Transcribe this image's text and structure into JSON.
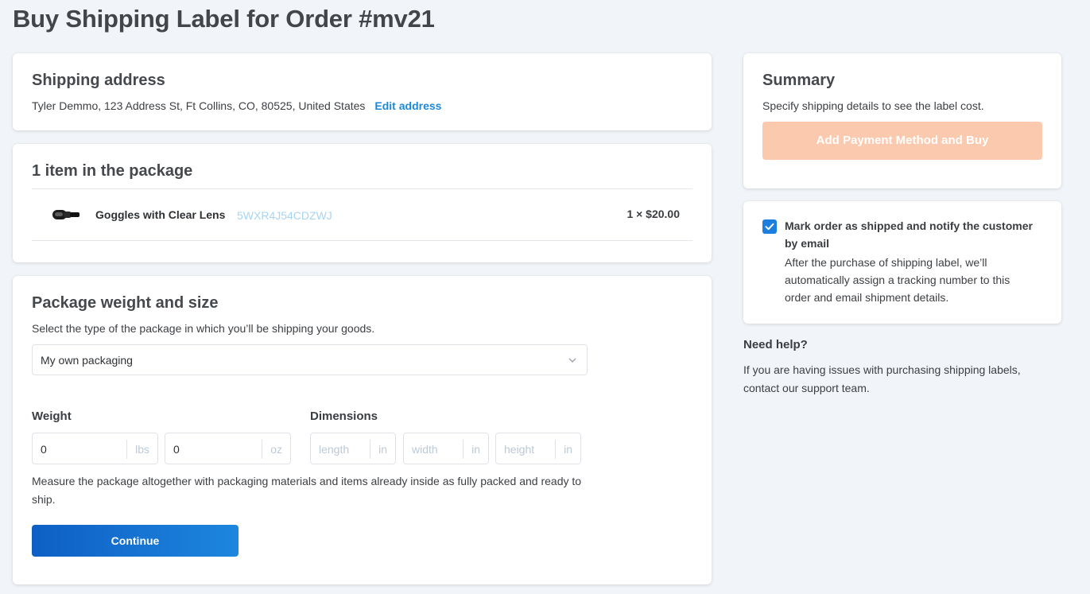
{
  "page": {
    "title": "Buy Shipping Label for Order #mv21"
  },
  "shipping_address": {
    "heading": "Shipping address",
    "address": "Tyler Demmo, 123 Address St, Ft Collins, CO, 80525, United States",
    "edit_link": "Edit address"
  },
  "package_items": {
    "heading": "1 item in the package",
    "items": [
      {
        "name": "Goggles with Clear Lens",
        "sku": "5WXR4J54CDZWJ",
        "price": "1 × $20.00",
        "icon": "goggles-thumbnail"
      }
    ]
  },
  "package_size": {
    "heading": "Package weight and size",
    "description": "Select the type of the package in which you’ll be shipping your goods.",
    "packaging_selected": "My own packaging",
    "weight_label": "Weight",
    "dimensions_label": "Dimensions",
    "weight_lbs": {
      "value": "0",
      "unit": "lbs"
    },
    "weight_oz": {
      "value": "0",
      "unit": "oz"
    },
    "length": {
      "placeholder": "length",
      "unit": "in"
    },
    "width": {
      "placeholder": "width",
      "unit": "in"
    },
    "height": {
      "placeholder": "height",
      "unit": "in"
    },
    "note": "Measure the package altogether with packaging materials and items already inside as fully packed and ready to ship.",
    "continue_label": "Continue"
  },
  "summary": {
    "heading": "Summary",
    "description": "Specify shipping details to see the label cost.",
    "buy_label": "Add Payment Method and Buy"
  },
  "mark_shipped": {
    "checked": true,
    "title": "Mark order as shipped and notify the customer by email",
    "description": "After the purchase of shipping label, we’ll automatically assign a tracking number to this order and email shipment details."
  },
  "help": {
    "heading": "Need help?",
    "description": "If you are having issues with purchasing shipping labels, contact our support team."
  },
  "colors": {
    "primary": "#1873d3",
    "buy_disabled": "#fbc9ad",
    "link": "#1c8ad8",
    "background": "#f1f4f8"
  }
}
